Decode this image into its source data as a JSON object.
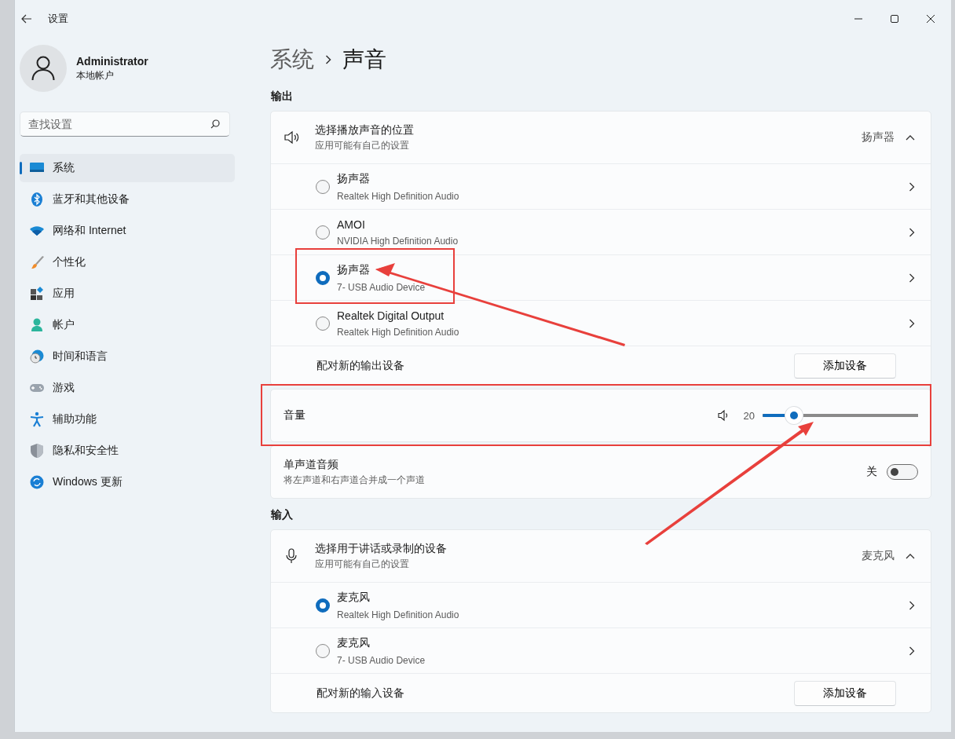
{
  "window": {
    "title": "设置"
  },
  "user": {
    "name": "Administrator",
    "account": "本地帐户"
  },
  "search": {
    "placeholder": "查找设置"
  },
  "sidebar": {
    "items": [
      {
        "label": "系统",
        "selected": true
      },
      {
        "label": "蓝牙和其他设备",
        "selected": false
      },
      {
        "label": "网络和 Internet",
        "selected": false
      },
      {
        "label": "个性化",
        "selected": false
      },
      {
        "label": "应用",
        "selected": false
      },
      {
        "label": "帐户",
        "selected": false
      },
      {
        "label": "时间和语言",
        "selected": false
      },
      {
        "label": "游戏",
        "selected": false
      },
      {
        "label": "辅助功能",
        "selected": false
      },
      {
        "label": "隐私和安全性",
        "selected": false
      },
      {
        "label": "Windows 更新",
        "selected": false
      }
    ]
  },
  "breadcrumb": [
    "系统",
    "声音"
  ],
  "sections": [
    {
      "kind": "output",
      "heading": "输出",
      "picker": {
        "title": "选择播放声音的位置",
        "subtitle": "应用可能有自己的设置",
        "value": "扬声器",
        "expanded": true
      },
      "devices": [
        {
          "name": "扬声器",
          "detail": "Realtek High Definition Audio",
          "selected": false
        },
        {
          "name": "AMOI",
          "detail": "NVIDIA High Definition Audio",
          "selected": false
        },
        {
          "name": "扬声器",
          "detail": "7- USB Audio Device",
          "selected": true
        },
        {
          "name": "Realtek Digital Output",
          "detail": "Realtek High Definition Audio",
          "selected": false
        }
      ],
      "pair": {
        "label": "配对新的输出设备",
        "button": "添加设备"
      },
      "volume": {
        "label": "音量",
        "value": "20",
        "level": 0.2
      },
      "mono": {
        "title": "单声道音频",
        "subtitle": "将左声道和右声道合并成一个声道",
        "state": "关",
        "on": false
      }
    },
    {
      "kind": "input",
      "heading": "输入",
      "picker": {
        "title": "选择用于讲话或录制的设备",
        "subtitle": "应用可能有自己的设置",
        "value": "麦克风",
        "expanded": true
      },
      "devices": [
        {
          "name": "麦克风",
          "detail": "Realtek High Definition Audio",
          "selected": true
        },
        {
          "name": "麦克风",
          "detail": "7- USB Audio Device",
          "selected": false
        }
      ],
      "pair": {
        "label": "配对新的输入设备",
        "button": "添加设备"
      }
    }
  ]
}
